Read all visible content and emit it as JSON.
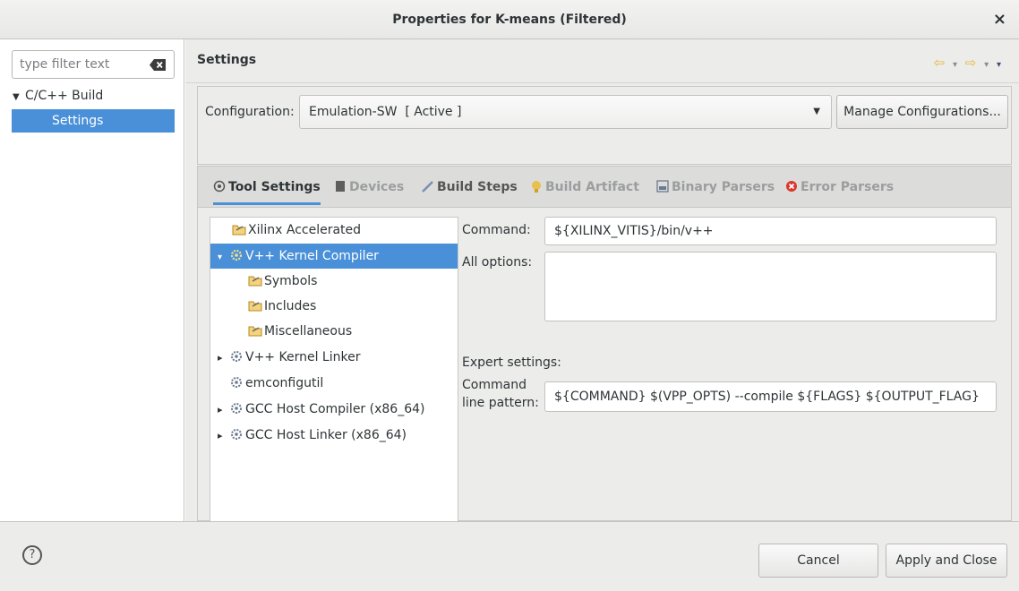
{
  "window": {
    "title": "Properties for K-means (Filtered)",
    "close_glyph": "×"
  },
  "sidebar": {
    "filter_placeholder": "type filter text",
    "items": [
      {
        "label": "C/C++ Build",
        "expanded": true
      },
      {
        "label": "Settings",
        "selected": true
      }
    ]
  },
  "header": {
    "title": "Settings",
    "nav": {
      "back_glyph": "⇦",
      "forward_glyph": "⇨",
      "dropdown_glyph": "▾"
    }
  },
  "configuration": {
    "label": "Configuration:",
    "selected": "Emulation-SW  [ Active ]",
    "manage_button": "Manage Configurations..."
  },
  "tabs": [
    {
      "label": "Tool Settings",
      "icon": "tool-settings-icon",
      "active": true
    },
    {
      "label": "Devices",
      "icon": "devices-icon",
      "active": false
    },
    {
      "label": "Build Steps",
      "icon": "build-steps-icon",
      "active": false
    },
    {
      "label": "Build Artifact",
      "icon": "build-artifact-icon",
      "active": false
    },
    {
      "label": "Binary Parsers",
      "icon": "binary-parsers-icon",
      "active": false
    },
    {
      "label": "Error Parsers",
      "icon": "error-parsers-icon",
      "active": false
    }
  ],
  "tool_tree": [
    {
      "label": "Xilinx Accelerated",
      "icon": "folder-icon",
      "expander": ""
    },
    {
      "label": "V++ Kernel Compiler",
      "icon": "gear-icon",
      "expander": "▾",
      "selected": true
    },
    {
      "label": "Symbols",
      "icon": "folder-icon",
      "expander": ""
    },
    {
      "label": "Includes",
      "icon": "folder-icon",
      "expander": ""
    },
    {
      "label": "Miscellaneous",
      "icon": "folder-icon",
      "expander": ""
    },
    {
      "label": "V++ Kernel Linker",
      "icon": "gear-icon",
      "expander": "▸"
    },
    {
      "label": "emconfigutil",
      "icon": "gear-icon",
      "expander": ""
    },
    {
      "label": "GCC Host Compiler (x86_64)",
      "icon": "gear-icon",
      "expander": "▸"
    },
    {
      "label": "GCC Host Linker (x86_64)",
      "icon": "gear-icon",
      "expander": "▸"
    }
  ],
  "tool_settings": {
    "command_label": "Command:",
    "command_value": "${XILINX_VITIS}/bin/v++",
    "all_options_label": "All options:",
    "all_options_value": "",
    "expert_label": "Expert settings:",
    "pattern_label_line1": "Command",
    "pattern_label_line2": "line pattern:",
    "pattern_value": "${COMMAND} $(VPP_OPTS) --compile ${FLAGS} ${OUTPUT_FLAG}"
  },
  "footer": {
    "help_glyph": "?",
    "cancel_label": "Cancel",
    "apply_label": "Apply and Close"
  },
  "colors": {
    "accent": "#4a90d9",
    "nav_arrow": "#e8b73a",
    "error": "#d9372b"
  }
}
